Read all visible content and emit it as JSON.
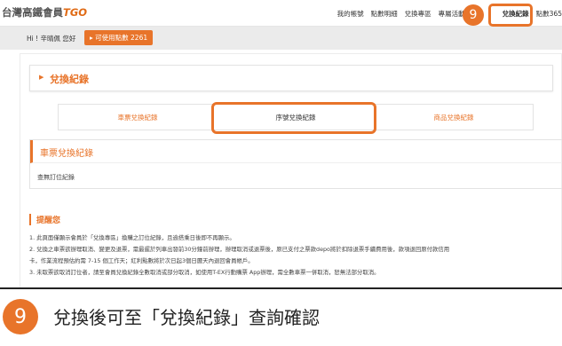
{
  "brand": {
    "name": "台灣高鐵會員",
    "suffix": "TGO"
  },
  "nav": {
    "items": [
      "我的帳號",
      "點數明細",
      "兌換專區",
      "專屬活動",
      "兌換紀錄",
      "點數365"
    ],
    "step_badge": "9"
  },
  "greeting": {
    "text": "Hi ! 辛晴佩 您好",
    "points_label": "可使用點數 2261",
    "points_icon": "chevron-right-icon"
  },
  "page": {
    "title": "兌換紀錄",
    "tabs": [
      "車票兌換紀錄",
      "序號兌換紀錄",
      "商品兌換紀錄"
    ],
    "active_tab_index": 1
  },
  "records": {
    "heading": "車票兌換紀錄",
    "empty_text": "查無訂位紀錄"
  },
  "reminder": {
    "title": "提醒您",
    "items": [
      "1. 此頁面僅顯示會員於「兌換專區」換購之訂位紀錄，且逾搭乘日後即不再顯示。",
      "2. 兌換之車票欲辦理取消、變更及退票，需最遲於列車出發前30分鐘前辦理，辦理取消或退票後，原已支付之票款depo將於扣除退票手續費用後，款項退回原付款信用",
      "卡，作業流程預估約需 7-15 個工作天；紅利點數將於次日起3個日曆天內退回會員帳戶。",
      "3. 未取票欲取消訂位者，請至會員兌換紀錄全數取消或部分取消，如使用T-EX行動購票 App辦理，需全數車票一併取消，恕無法部分取消。"
    ]
  },
  "caption": {
    "step": "9",
    "text": "兌換後可至「兌換紀錄」查詢確認"
  },
  "colors": {
    "accent": "#e8742a",
    "strip": "#ebebeb"
  }
}
